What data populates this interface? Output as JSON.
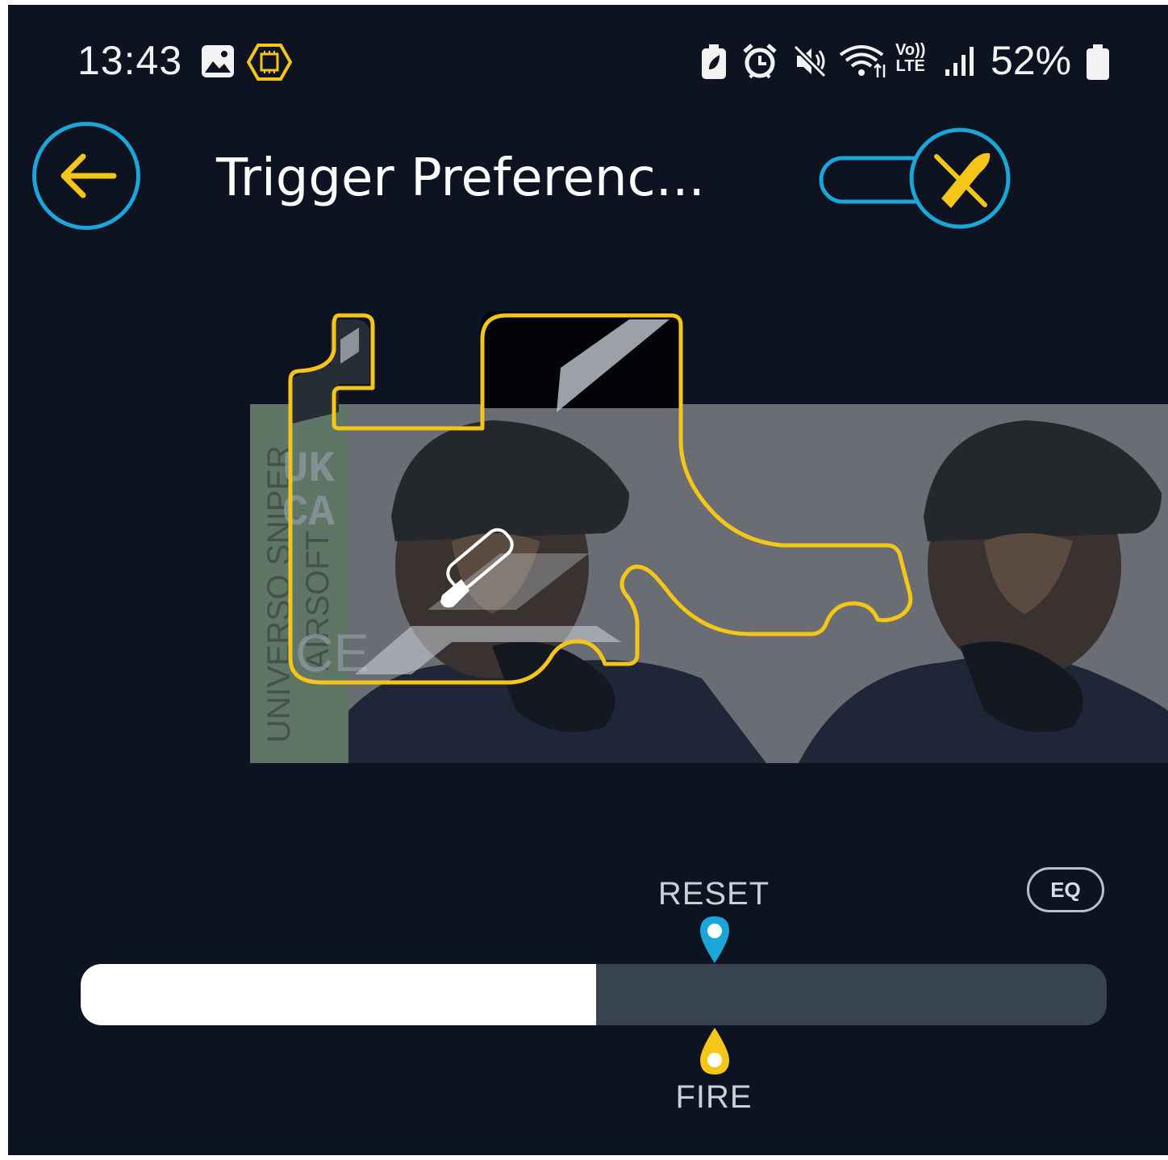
{
  "status_bar": {
    "time": "13:43",
    "left_icons": [
      "gallery-icon",
      "chip-icon"
    ],
    "right_icons": [
      "battery-saver-icon",
      "alarm-icon",
      "mute-icon",
      "wifi-icon",
      "volte-icon",
      "signal-icon",
      "battery-icon"
    ],
    "volte_top": "Vo))",
    "volte_bottom": "LTE",
    "battery_percent": "52%"
  },
  "header": {
    "title": "Trigger Preferenc...",
    "back_icon": "arrow-left-icon",
    "toggle_icon": "no-bullet-icon"
  },
  "preview": {
    "overlay_text_vertical_1": "UNIVERSO SNIPER",
    "overlay_text_vertical_2": "AIRSOFT",
    "overlay_mark_1": "UK",
    "overlay_mark_2": "CA",
    "overlay_mark_3": "CE"
  },
  "trigger_control": {
    "eq_label": "EQ",
    "reset_label": "RESET",
    "fire_label": "FIRE",
    "slider_value_percent": 50.2,
    "reset_point_percent": 61.8,
    "fire_point_percent": 61.8
  },
  "colors": {
    "background": "#0d1320",
    "accent_blue": "#1aa6d8",
    "accent_yellow": "#f5c518",
    "track": "#37434e",
    "fill": "#ffffff"
  }
}
